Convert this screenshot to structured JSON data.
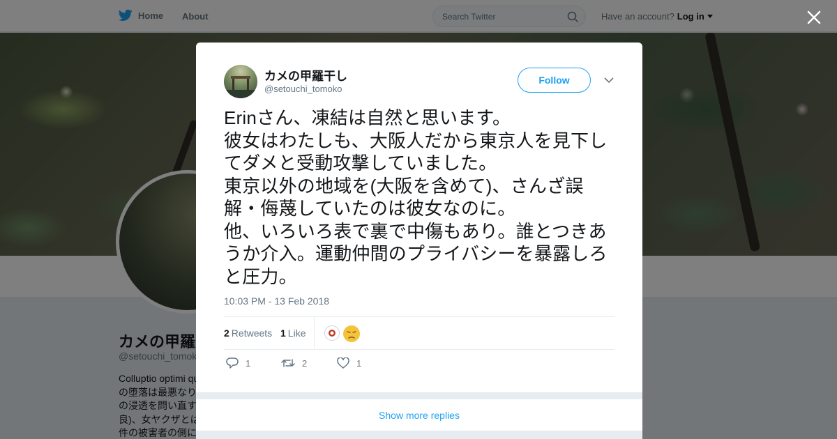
{
  "nav": {
    "home_label": "Home",
    "about_label": "About",
    "search_placeholder": "Search Twitter",
    "have_account": "Have an account?",
    "login_label": "Log in"
  },
  "profile": {
    "name": "カメの甲羅干し",
    "handle": "@setouchi_tomoko",
    "bio": "Colluptio optimi qu\nの堕落は最悪なり\nの浸透を問い直す\n良)、女ヤクザとは\n件の被害者の側に"
  },
  "tweet": {
    "author_name": "カメの甲羅干し",
    "author_handle": "@setouchi_tomoko",
    "follow_label": "Follow",
    "text": "Erinさん、凍結は自然と思います。\n彼女はわたしも、大阪人だから東京人を見下してダメと受動攻撃していました。\n東京以外の地域を(大阪を含めて)、さんざ誤解・侮蔑していたのは彼女なのに。\n他、いろいろ表で裏で中傷もあり。誰とつきあうか介入。運動仲間のプライバシーを暴露しろと圧力。",
    "timestamp": "10:03 PM - 13 Feb 2018",
    "retweets_count": "2",
    "retweets_label": "Retweets",
    "likes_count": "1",
    "likes_label": "Like",
    "reply_action_count": "1",
    "retweet_action_count": "2",
    "like_action_count": "1"
  },
  "show_more_label": "Show more replies",
  "colors": {
    "accent": "#1da1f2",
    "secondary_text": "#657786",
    "overlay": "rgba(0,0,0,0.5)"
  },
  "icons": [
    "twitter-bird-icon",
    "search-icon",
    "caret-down-icon",
    "close-icon",
    "chevron-down-icon",
    "reply-icon",
    "retweet-icon",
    "heart-icon"
  ]
}
